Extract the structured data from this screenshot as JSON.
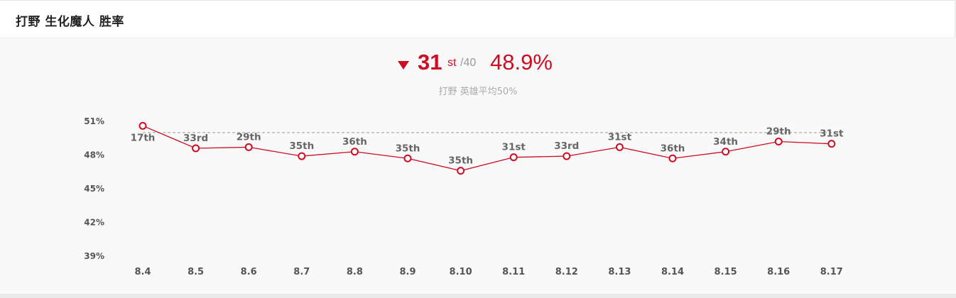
{
  "header": {
    "title": "打野 生化魔人 胜率"
  },
  "summary": {
    "trend": "down",
    "rank": "31",
    "rank_suffix": "st",
    "rank_total": "/40",
    "win_rate": "48.9%",
    "average_note": "打野 英雄平均50%"
  },
  "colors": {
    "accent": "#cc0c22",
    "reference_line": "#999999",
    "text_muted": "#aaaaaa"
  },
  "chart_data": {
    "type": "line",
    "categories": [
      "8.4",
      "8.5",
      "8.6",
      "8.7",
      "8.8",
      "8.9",
      "8.10",
      "8.11",
      "8.12",
      "8.13",
      "8.14",
      "8.15",
      "8.16",
      "8.17"
    ],
    "series": [
      {
        "values": [
          50.6,
          48.6,
          48.7,
          47.9,
          48.3,
          47.7,
          46.6,
          47.8,
          47.9,
          48.7,
          47.7,
          48.3,
          49.2,
          49.0
        ],
        "point_labels": [
          "17th",
          "33rd",
          "29th",
          "35th",
          "36th",
          "35th",
          "35th",
          "31st",
          "33rd",
          "31st",
          "36th",
          "34th",
          "29th",
          "31st"
        ]
      }
    ],
    "reference_line": {
      "value": 50
    },
    "yticks": [
      "51%",
      "48%",
      "45%",
      "42%",
      "39%"
    ],
    "ytick_values": [
      51,
      48,
      45,
      42,
      39
    ],
    "ylim": [
      39,
      51
    ],
    "grid": false,
    "legend": "none"
  }
}
